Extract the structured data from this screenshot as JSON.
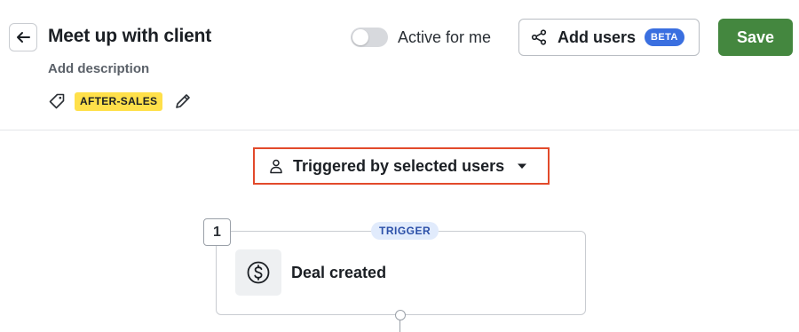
{
  "header": {
    "title": "Meet up with client",
    "add_description": "Add description",
    "tag": "AFTER-SALES",
    "toggle_label": "Active for me",
    "toggle_on": false,
    "add_users_label": "Add users",
    "beta_label": "BETA",
    "save_label": "Save"
  },
  "trigger_selector": {
    "label": "Triggered by selected users",
    "icon": "user-icon"
  },
  "flow": {
    "step_number": "1",
    "step_type": "TRIGGER",
    "step_label": "Deal created",
    "step_icon": "dollar-circle-icon"
  },
  "colors": {
    "save": "#44873f",
    "beta": "#3a6fe0",
    "tag": "#ffe04a",
    "highlight": "#e24a2b",
    "trigger_badge_bg": "#e1ebfc"
  }
}
